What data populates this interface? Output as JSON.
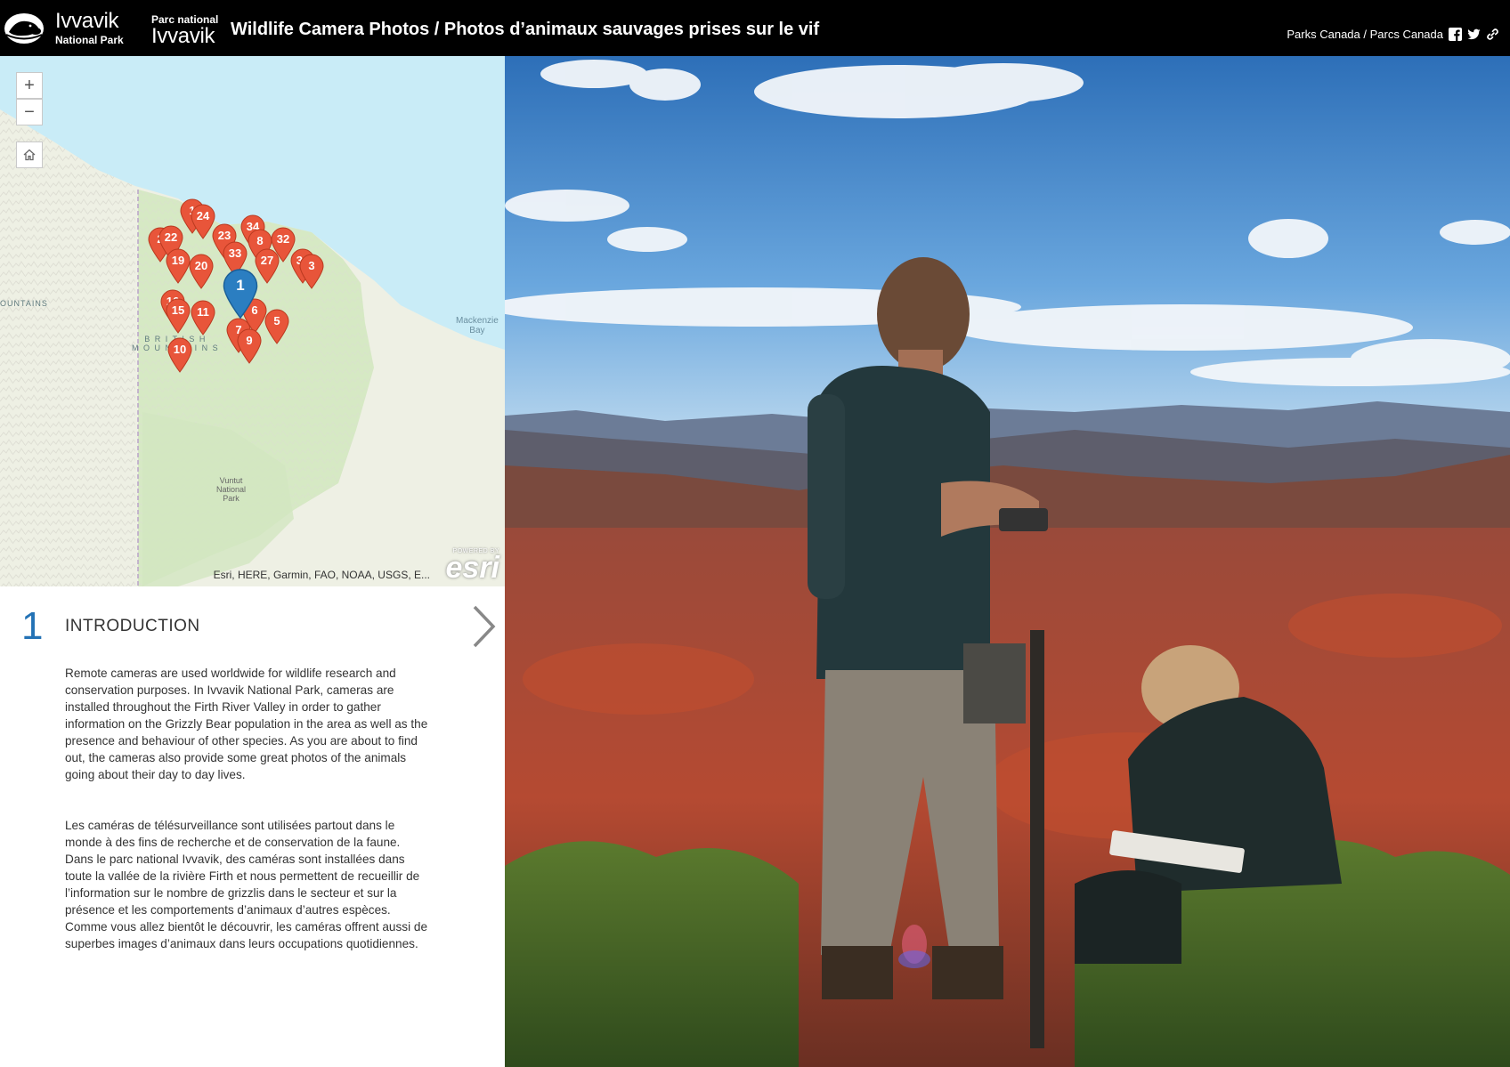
{
  "header": {
    "brand_en_name": "Ivvavik",
    "brand_en_sub": "National Park",
    "brand_fr_sub": "Parc national",
    "brand_fr_name": "Ivvavik",
    "title": "Wildlife Camera Photos / Photos d’animaux sauvages prises sur le vif",
    "agency_link": "Parks Canada / Parcs Canada",
    "icons": [
      "facebook-icon",
      "twitter-icon",
      "link-icon"
    ]
  },
  "map": {
    "zoom_in": "+",
    "zoom_out": "−",
    "labels": {
      "mackenzie": "Mackenzie\nBay",
      "mountains": "OUNTAINS",
      "british": "B R I T I S H\nM O U N T A I N S",
      "vuntut": "Vuntut\nNational\nPark"
    },
    "attribution": "Esri, HERE, Garmin, FAO, NOAA, USGS, E...",
    "esri_powered": "POWERED BY",
    "esri_logo": "esri",
    "markers": [
      "1",
      "24",
      "2",
      "22",
      "23",
      "34",
      "8",
      "32",
      "33",
      "19",
      "20",
      "27",
      "31",
      "3",
      "16",
      "15",
      "11",
      "6",
      "5",
      "7",
      "9",
      "10"
    ],
    "active_marker": "1",
    "colors": {
      "marker": "#e8553a",
      "active_marker": "#2b7ec1",
      "water": "#c9ecf7",
      "land": "#eef0e6",
      "park": "#d9ebc8"
    }
  },
  "story": {
    "number": "1",
    "title": "INTRODUCTION",
    "para_en": "Remote cameras are used worldwide for wildlife research and conservation purposes. In Ivvavik National Park, cameras are installed throughout the Firth River Valley in order to gather information on the Grizzly Bear population in the area as well as the presence and behaviour of other species. As you are about to find out, the cameras also provide some great photos of the animals going about their day to day lives.",
    "para_fr": "Les caméras de télésurveillance sont utilisées partout dans le monde à des fins de recherche et de conservation de la faune. Dans le parc national Ivvavik, des caméras sont installées dans toute la vallée de la rivière Firth et nous permettent de recueillir de l’information sur le nombre de grizzlis dans le secteur et sur la présence et les comportements d’animaux d’autres espèces. Comme vous allez bientôt le découvrir, les caméras offrent aussi de superbes images d’animaux dans leurs occupations quotidiennes.",
    "accent_color": "#2372b5"
  }
}
